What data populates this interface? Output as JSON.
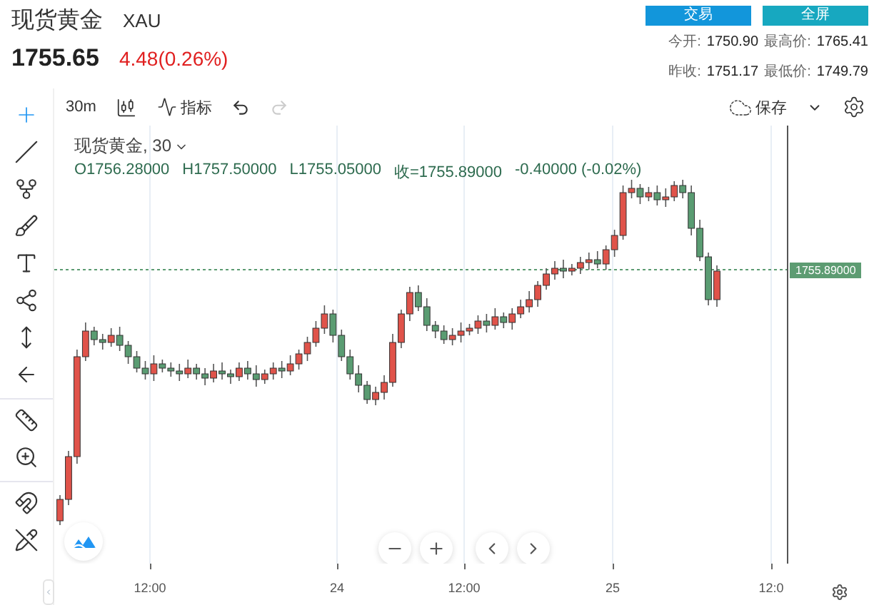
{
  "header": {
    "name": "现货黄金",
    "symbol": "XAU",
    "price": "1755.65",
    "change": "4.48(0.26%)",
    "buttons": [
      {
        "label": "交易",
        "kind": "trade"
      },
      {
        "label": "全屏",
        "kind": "fullscreen"
      }
    ],
    "stats": [
      {
        "label": "今开:",
        "value": "1750.90"
      },
      {
        "label": "最高价:",
        "value": "1765.41"
      },
      {
        "label": "昨收:",
        "value": "1751.17"
      },
      {
        "label": "最低价:",
        "value": "1749.79"
      }
    ]
  },
  "toolbar": {
    "interval": "30m",
    "indicators": "指标",
    "redo_disabled": true,
    "save": "保存"
  },
  "tool_groups": [
    {
      "tools": [
        {
          "kind": "crosshair",
          "selected": true
        },
        {
          "kind": "line",
          "selected": false
        },
        {
          "kind": "fork",
          "selected": false
        },
        {
          "kind": "brush",
          "selected": false
        },
        {
          "kind": "text",
          "selected": false
        },
        {
          "kind": "nodes",
          "selected": false
        },
        {
          "kind": "measure",
          "selected": false
        },
        {
          "kind": "back",
          "selected": false
        }
      ]
    },
    {
      "tools": [
        {
          "kind": "ruler",
          "selected": false
        },
        {
          "kind": "zoom",
          "selected": false
        }
      ]
    },
    {
      "tools": [
        {
          "kind": "magnet",
          "selected": false
        },
        {
          "kind": "lock",
          "selected": false
        }
      ]
    }
  ],
  "legend": {
    "title": "现货黄金, 30",
    "values": [
      "O1756.28000",
      "H1757.50000",
      "L1755.05000",
      "收=1755.89000",
      "-0.40000 (-0.02%)"
    ]
  },
  "chart": {
    "last_price": "1755.89000",
    "time_labels": [
      "12:00",
      "24",
      "12:00",
      "25",
      "12:0"
    ]
  }
}
